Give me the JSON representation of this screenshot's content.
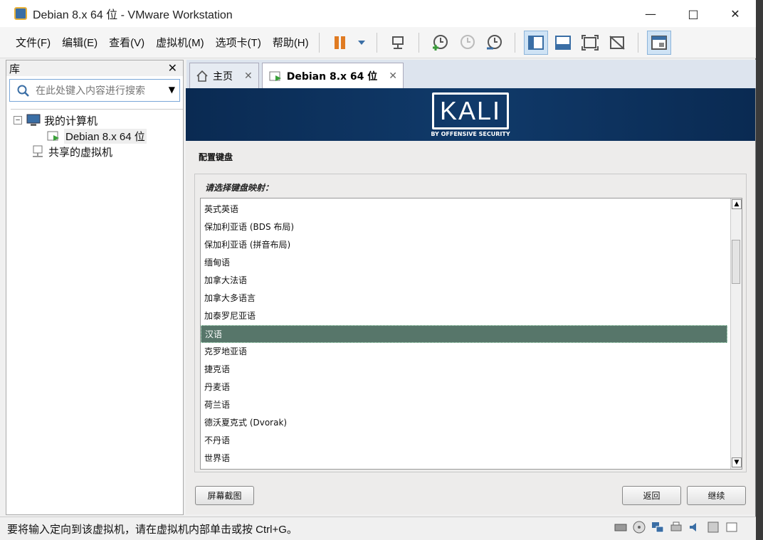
{
  "window": {
    "title": "Debian 8.x 64 位 - VMware Workstation"
  },
  "menubar": {
    "items": [
      "文件(F)",
      "编辑(E)",
      "查看(V)",
      "虚拟机(M)",
      "选项卡(T)",
      "帮助(H)"
    ]
  },
  "library": {
    "title": "库",
    "search_placeholder": "在此处键入内容进行搜索",
    "tree": {
      "root": "我的计算机",
      "vm": "Debian 8.x 64 位",
      "shared": "共享的虚拟机"
    }
  },
  "tabs": [
    {
      "label": "主页"
    },
    {
      "label": "Debian 8.x 64 位"
    }
  ],
  "vm": {
    "logo_text": "KALI",
    "logo_sub": "BY OFFENSIVE SECURITY",
    "heading": "配置键盘",
    "prompt": "请选择键盘映射：",
    "items": [
      "英式英语",
      "保加利亚语 (BDS 布局)",
      "保加利亚语 (拼音布局)",
      "缅甸语",
      "加拿大法语",
      "加拿大多语言",
      "加泰罗尼亚语",
      "汉语",
      "克罗地亚语",
      "捷克语",
      "丹麦语",
      "荷兰语",
      "德沃夏克式 (Dvorak)",
      "不丹语",
      "世界语"
    ],
    "selected": "汉语",
    "screenshot_btn": "屏幕截图",
    "back_btn": "返回",
    "continue_btn": "继续"
  },
  "statusbar": {
    "text": "要将输入定向到该虚拟机，请在虚拟机内部单击或按 Ctrl+G。"
  }
}
